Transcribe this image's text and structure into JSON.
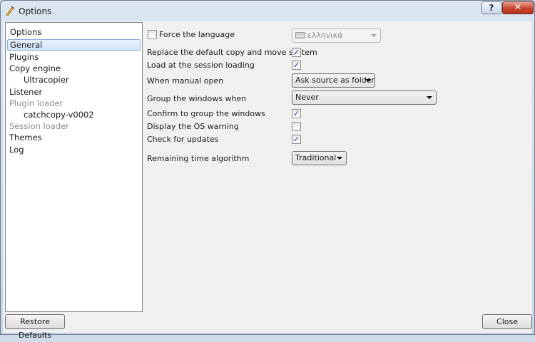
{
  "window": {
    "title": "Options",
    "help_label": "?",
    "close_glyph": "✕"
  },
  "sidebar": {
    "header": "Options",
    "items": [
      {
        "label": "General"
      },
      {
        "label": "Plugins"
      },
      {
        "label": "Copy engine"
      },
      {
        "label": "Ultracopier"
      },
      {
        "label": "Listener"
      },
      {
        "label": "Plugin loader"
      },
      {
        "label": "catchcopy-v0002"
      },
      {
        "label": "Session loader"
      },
      {
        "label": "Themes"
      },
      {
        "label": "Log"
      }
    ]
  },
  "general": {
    "force_language": {
      "label": "Force the language",
      "checked": false,
      "value": "ελληνικά"
    },
    "replace_default": {
      "label": "Replace the default copy and move system",
      "checked": true
    },
    "load_session": {
      "label": "Load at the session loading",
      "checked": true
    },
    "manual_open": {
      "label": "When manual open",
      "value": "Ask source as folder"
    },
    "group_windows_when": {
      "label": "Group the windows when",
      "value": "Never"
    },
    "confirm_group": {
      "label": "Confirm to group the windows",
      "checked": true
    },
    "os_warning": {
      "label": "Display the OS warning",
      "checked": false
    },
    "check_updates": {
      "label": "Check for updates",
      "checked": true
    },
    "remaining_time": {
      "label": "Remaining time algorithm",
      "value": "Traditional"
    }
  },
  "footer": {
    "restore_label": "Restore Defaults",
    "close_label": "Close"
  },
  "check_glyph": "✓"
}
